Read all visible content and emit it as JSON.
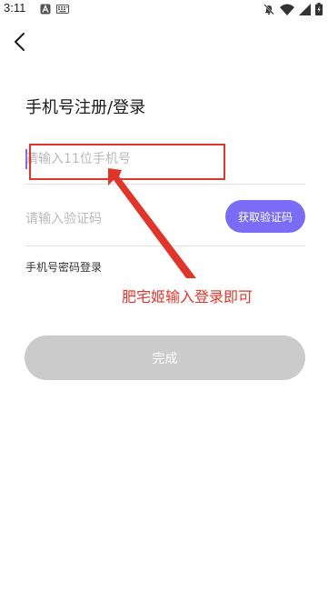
{
  "status_bar": {
    "time": "3:11",
    "icons": [
      "text-a-icon",
      "keyboard-icon",
      "bell-off-icon",
      "wifi-icon",
      "signal-icon",
      "battery-charging-icon"
    ]
  },
  "nav": {
    "back_icon": "chevron-left-icon"
  },
  "page": {
    "title": "手机号注册/登录"
  },
  "form": {
    "phone_placeholder": "请输入11位手机号",
    "phone_value": "",
    "code_placeholder": "请输入验证码",
    "code_value": "",
    "get_code_label": "获取验证码",
    "password_login_label": "手机号密码登录",
    "submit_label": "完成"
  },
  "annotation": {
    "text": "肥宅姬输入登录即可",
    "color": "#e0352b"
  },
  "colors": {
    "accent": "#7b6cf6",
    "disabled_button": "#cbcbcb",
    "annotation_red": "#e0352b"
  }
}
